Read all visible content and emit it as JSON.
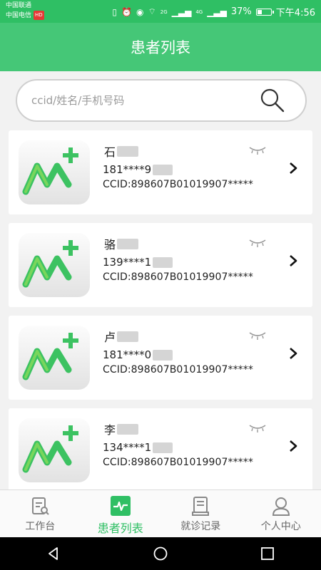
{
  "status_bar": {
    "carrier_1": "中国联通",
    "carrier_2": "中国电信",
    "carrier_badge": "HD",
    "signal_1": "2G",
    "signal_2": "4G",
    "battery": "37%",
    "battery_level": 0.37,
    "time": "下午4:56"
  },
  "header": {
    "title": "患者列表"
  },
  "search": {
    "placeholder": "ccid/姓名/手机号码",
    "value": ""
  },
  "patients": [
    {
      "name": "石",
      "phone": "181****9",
      "ccid": "CCID:898607B01019907*****"
    },
    {
      "name": "骆",
      "phone": "139****1",
      "ccid": "CCID:898607B01019907*****"
    },
    {
      "name": "卢",
      "phone": "181****0",
      "ccid": "CCID:898607B01019907*****"
    },
    {
      "name": "李",
      "phone": "134****1",
      "ccid": "CCID:898607B01019907*****"
    }
  ],
  "tabs": [
    {
      "label": "工作台",
      "icon": "clipboard-icon",
      "active": false
    },
    {
      "label": "患者列表",
      "icon": "pulse-icon",
      "active": true
    },
    {
      "label": "就诊记录",
      "icon": "record-icon",
      "active": false
    },
    {
      "label": "个人中心",
      "icon": "user-icon",
      "active": false
    }
  ],
  "colors": {
    "accent": "#2fbf64",
    "header": "#45c777",
    "logo_green": "#3cc261"
  }
}
